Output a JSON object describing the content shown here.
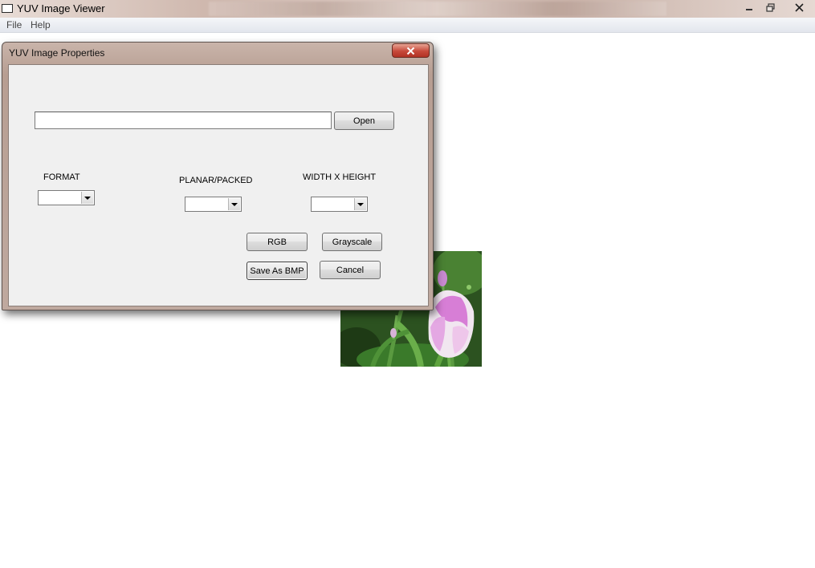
{
  "window": {
    "title": "YUV Image Viewer",
    "controls": {
      "minimize_icon": "minimize-icon",
      "maximize_icon": "restore-icon",
      "close_icon": "close-icon"
    }
  },
  "menu": {
    "items": [
      "File",
      "Help"
    ]
  },
  "dialog": {
    "title": "YUV Image Properties",
    "close_label": "✕",
    "path_input": {
      "value": "",
      "placeholder": ""
    },
    "open_label": "Open",
    "format": {
      "label": "FORMAT",
      "selected": ""
    },
    "planar_packed": {
      "label": "PLANAR/PACKED",
      "selected": ""
    },
    "width_height": {
      "label": "WIDTH X HEIGHT",
      "selected": ""
    },
    "buttons": {
      "rgb": "RGB",
      "grayscale": "Grayscale",
      "save_bmp": "Save As BMP",
      "cancel": "Cancel"
    }
  },
  "colors": {
    "dialog_client_bg": "#f0f0f0",
    "close_button": "#c7493a"
  },
  "background_image": {
    "subject": "pink-white tulip in green foliage"
  }
}
